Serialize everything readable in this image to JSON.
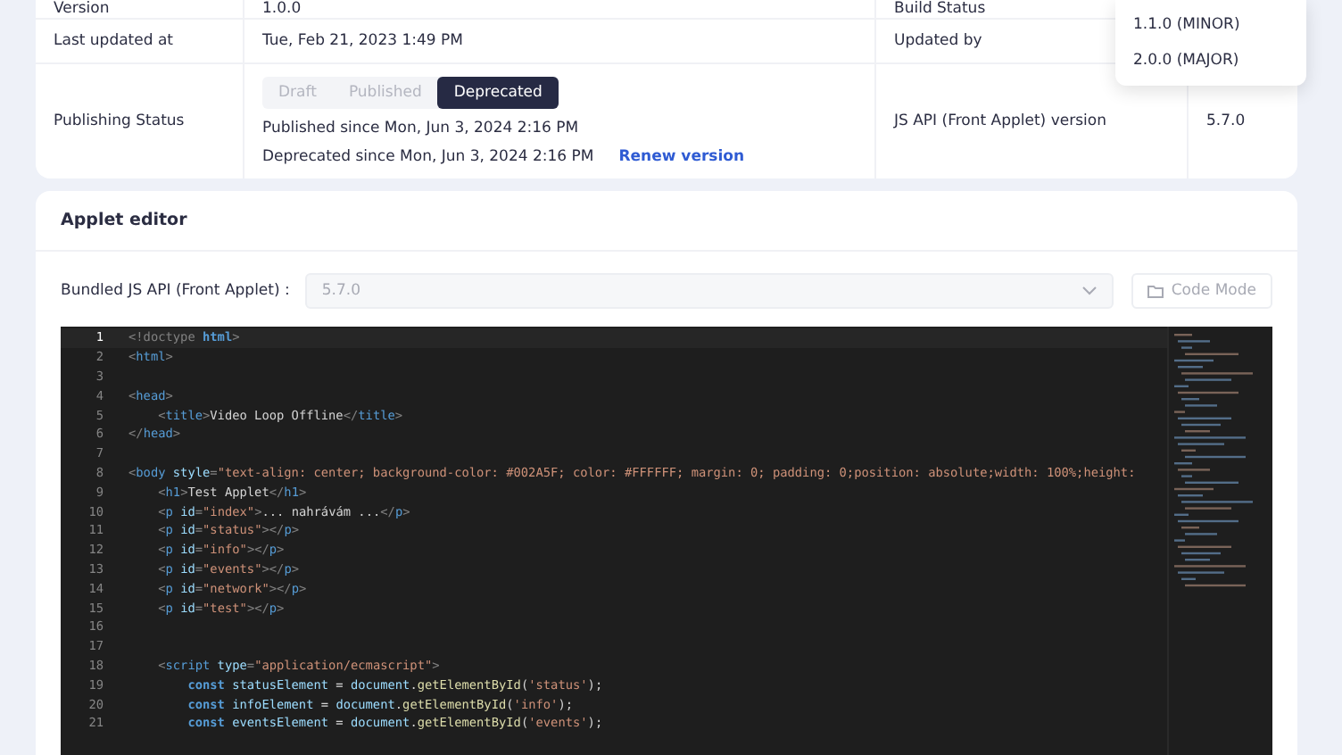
{
  "details": {
    "rows": [
      {
        "label": "Version",
        "value": "1.0.0",
        "label_2": "Build Status",
        "value_2": ""
      },
      {
        "label": "Last updated at",
        "value": "Tue, Feb 21, 2023 1:49 PM",
        "label_2": "Updated by",
        "value_2": ""
      },
      {
        "label": "Publishing Status",
        "kind": "status",
        "label_2": "JS API (Front Applet) version",
        "value_2": "5.7.0"
      }
    ],
    "status_options": [
      {
        "label": "Draft",
        "selected": false
      },
      {
        "label": "Published",
        "selected": false
      },
      {
        "label": "Deprecated",
        "selected": true
      }
    ],
    "published_since": "Published since Mon, Jun 3, 2024 2:16 PM",
    "deprecated_since": "Deprecated since Mon, Jun 3, 2024 2:16 PM",
    "renew_link": "Renew version"
  },
  "version_menu": {
    "items": [
      "1.1.0 (MINOR)",
      "2.0.0 (MAJOR)"
    ]
  },
  "editor": {
    "title": "Applet editor",
    "api_label": "Bundled JS API (Front Applet) :",
    "api_value": "5.7.0",
    "code_mode_button": "Code Mode",
    "lines": [
      {
        "n": "1",
        "active": true,
        "tokens": [
          {
            "kind": "punct",
            "text": "<!doctype "
          },
          {
            "kind": "keyword",
            "text": "html"
          },
          {
            "kind": "punct",
            "text": ">"
          }
        ]
      },
      {
        "n": "2",
        "active": false,
        "tokens": [
          {
            "kind": "punct",
            "text": "<"
          },
          {
            "kind": "tag",
            "text": "html"
          },
          {
            "kind": "punct",
            "text": ">"
          }
        ]
      },
      {
        "n": "3",
        "active": false
      },
      {
        "n": "4",
        "active": false,
        "tokens": [
          {
            "kind": "punct",
            "text": "<"
          },
          {
            "kind": "tag",
            "text": "head"
          },
          {
            "kind": "punct",
            "text": ">"
          }
        ]
      },
      {
        "n": "5",
        "active": false,
        "tokens": [
          {
            "kind": "punct",
            "text": "    <"
          },
          {
            "kind": "tag",
            "text": "title"
          },
          {
            "kind": "punct",
            "text": ">"
          },
          {
            "kind": "plain",
            "text": "Video Loop Offline"
          },
          {
            "kind": "punct",
            "text": "</"
          },
          {
            "kind": "tag",
            "text": "title"
          },
          {
            "kind": "punct",
            "text": ">"
          }
        ]
      },
      {
        "n": "6",
        "active": false,
        "tokens": [
          {
            "kind": "punct",
            "text": "</"
          },
          {
            "kind": "tag",
            "text": "head"
          },
          {
            "kind": "punct",
            "text": ">"
          }
        ]
      },
      {
        "n": "7",
        "active": false
      },
      {
        "n": "8",
        "active": false,
        "tokens": [
          {
            "kind": "punct",
            "text": "<"
          },
          {
            "kind": "tag",
            "text": "body "
          },
          {
            "kind": "attr",
            "text": "style"
          },
          {
            "kind": "punct",
            "text": "="
          },
          {
            "kind": "string",
            "text": "\"text-align: center; background-color: #002A5F; color: #FFFFFF; margin: 0; padding: 0;position: absolute;width: 100%;height:"
          }
        ]
      },
      {
        "n": "9",
        "active": false,
        "tokens": [
          {
            "kind": "punct",
            "text": "    <"
          },
          {
            "kind": "tag",
            "text": "h1"
          },
          {
            "kind": "punct",
            "text": ">"
          },
          {
            "kind": "plain",
            "text": "Test Applet"
          },
          {
            "kind": "punct",
            "text": "</"
          },
          {
            "kind": "tag",
            "text": "h1"
          },
          {
            "kind": "punct",
            "text": ">"
          }
        ]
      },
      {
        "n": "10",
        "active": false,
        "tokens": [
          {
            "kind": "punct",
            "text": "    <"
          },
          {
            "kind": "tag",
            "text": "p "
          },
          {
            "kind": "attr",
            "text": "id"
          },
          {
            "kind": "punct",
            "text": "="
          },
          {
            "kind": "string",
            "text": "\"index\""
          },
          {
            "kind": "punct",
            "text": ">"
          },
          {
            "kind": "plain",
            "text": "... nahrávám ..."
          },
          {
            "kind": "punct",
            "text": "</"
          },
          {
            "kind": "tag",
            "text": "p"
          },
          {
            "kind": "punct",
            "text": ">"
          }
        ]
      },
      {
        "n": "11",
        "active": false,
        "tokens": [
          {
            "kind": "punct",
            "text": "    <"
          },
          {
            "kind": "tag",
            "text": "p "
          },
          {
            "kind": "attr",
            "text": "id"
          },
          {
            "kind": "punct",
            "text": "="
          },
          {
            "kind": "string",
            "text": "\"status\""
          },
          {
            "kind": "punct",
            "text": "></"
          },
          {
            "kind": "tag",
            "text": "p"
          },
          {
            "kind": "punct",
            "text": ">"
          }
        ]
      },
      {
        "n": "12",
        "active": false,
        "tokens": [
          {
            "kind": "punct",
            "text": "    <"
          },
          {
            "kind": "tag",
            "text": "p "
          },
          {
            "kind": "attr",
            "text": "id"
          },
          {
            "kind": "punct",
            "text": "="
          },
          {
            "kind": "string",
            "text": "\"info\""
          },
          {
            "kind": "punct",
            "text": "></"
          },
          {
            "kind": "tag",
            "text": "p"
          },
          {
            "kind": "punct",
            "text": ">"
          }
        ]
      },
      {
        "n": "13",
        "active": false,
        "tokens": [
          {
            "kind": "punct",
            "text": "    <"
          },
          {
            "kind": "tag",
            "text": "p "
          },
          {
            "kind": "attr",
            "text": "id"
          },
          {
            "kind": "punct",
            "text": "="
          },
          {
            "kind": "string",
            "text": "\"events\""
          },
          {
            "kind": "punct",
            "text": "></"
          },
          {
            "kind": "tag",
            "text": "p"
          },
          {
            "kind": "punct",
            "text": ">"
          }
        ]
      },
      {
        "n": "14",
        "active": false,
        "tokens": [
          {
            "kind": "punct",
            "text": "    <"
          },
          {
            "kind": "tag",
            "text": "p "
          },
          {
            "kind": "attr",
            "text": "id"
          },
          {
            "kind": "punct",
            "text": "="
          },
          {
            "kind": "string",
            "text": "\"network\""
          },
          {
            "kind": "punct",
            "text": "></"
          },
          {
            "kind": "tag",
            "text": "p"
          },
          {
            "kind": "punct",
            "text": ">"
          }
        ]
      },
      {
        "n": "15",
        "active": false,
        "tokens": [
          {
            "kind": "punct",
            "text": "    <"
          },
          {
            "kind": "tag",
            "text": "p "
          },
          {
            "kind": "attr",
            "text": "id"
          },
          {
            "kind": "punct",
            "text": "="
          },
          {
            "kind": "string",
            "text": "\"test\""
          },
          {
            "kind": "punct",
            "text": "></"
          },
          {
            "kind": "tag",
            "text": "p"
          },
          {
            "kind": "punct",
            "text": ">"
          }
        ]
      },
      {
        "n": "16",
        "active": false
      },
      {
        "n": "17",
        "active": false
      },
      {
        "n": "18",
        "active": false,
        "tokens": [
          {
            "kind": "punct",
            "text": "    <"
          },
          {
            "kind": "tag",
            "text": "script "
          },
          {
            "kind": "attr",
            "text": "type"
          },
          {
            "kind": "punct",
            "text": "="
          },
          {
            "kind": "string",
            "text": "\"application/ecmascript\""
          },
          {
            "kind": "punct",
            "text": ">"
          }
        ]
      },
      {
        "n": "19",
        "active": false,
        "tokens": [
          {
            "kind": "keyword",
            "text": "        const "
          },
          {
            "kind": "var",
            "text": "statusElement"
          },
          {
            "kind": "plain",
            "text": " = "
          },
          {
            "kind": "var",
            "text": "document"
          },
          {
            "kind": "plain",
            "text": "."
          },
          {
            "kind": "func",
            "text": "getElementById"
          },
          {
            "kind": "plain",
            "text": "("
          },
          {
            "kind": "string",
            "text": "'status'"
          },
          {
            "kind": "plain",
            "text": ");"
          }
        ]
      },
      {
        "n": "20",
        "active": false,
        "tokens": [
          {
            "kind": "keyword",
            "text": "        const "
          },
          {
            "kind": "var",
            "text": "infoElement"
          },
          {
            "kind": "plain",
            "text": " = "
          },
          {
            "kind": "var",
            "text": "document"
          },
          {
            "kind": "plain",
            "text": "."
          },
          {
            "kind": "func",
            "text": "getElementById"
          },
          {
            "kind": "plain",
            "text": "("
          },
          {
            "kind": "string",
            "text": "'info'"
          },
          {
            "kind": "plain",
            "text": ");"
          }
        ]
      },
      {
        "n": "21",
        "active": false,
        "tokens": [
          {
            "kind": "keyword",
            "text": "        const "
          },
          {
            "kind": "var",
            "text": "eventsElement"
          },
          {
            "kind": "plain",
            "text": " = "
          },
          {
            "kind": "var",
            "text": "document"
          },
          {
            "kind": "plain",
            "text": "."
          },
          {
            "kind": "func",
            "text": "getElementById"
          },
          {
            "kind": "plain",
            "text": "("
          },
          {
            "kind": "string",
            "text": "'events'"
          },
          {
            "kind": "plain",
            "text": ");"
          }
        ]
      }
    ]
  }
}
